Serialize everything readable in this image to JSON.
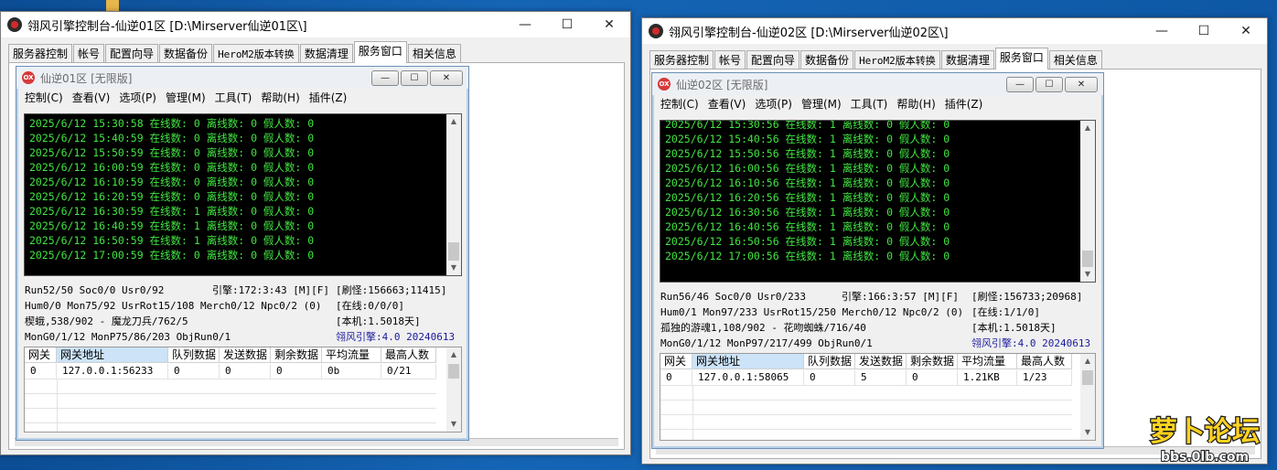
{
  "windows": [
    {
      "title": "翎风引擎控制台-仙逆01区 [D:\\Mirserver仙逆01区\\]",
      "tabs": [
        "服务器控制",
        "帐号",
        "配置向导",
        "数据备份",
        "HeroM2版本转换",
        "数据清理",
        "服务窗口",
        "相关信息"
      ],
      "active_tab": "服务窗口",
      "inner": {
        "title": "仙逆01区 [无限版]",
        "icon_text": "OX",
        "menus": [
          "控制(C)",
          "查看(V)",
          "选项(P)",
          "管理(M)",
          "工具(T)",
          "帮助(H)",
          "插件(Z)"
        ],
        "log": [
          "2025/6/12 15:30:58 在线数: 0 离线数: 0 假人数: 0",
          "2025/6/12 15:40:59 在线数: 0 离线数: 0 假人数: 0",
          "2025/6/12 15:50:59 在线数: 0 离线数: 0 假人数: 0",
          "2025/6/12 16:00:59 在线数: 0 离线数: 0 假人数: 0",
          "2025/6/12 16:10:59 在线数: 0 离线数: 0 假人数: 0",
          "2025/6/12 16:20:59 在线数: 0 离线数: 0 假人数: 0",
          "2025/6/12 16:30:59 在线数: 1 离线数: 0 假人数: 0",
          "2025/6/12 16:40:59 在线数: 1 离线数: 0 假人数: 0",
          "2025/6/12 16:50:59 在线数: 1 离线数: 0 假人数: 0",
          "2025/6/12 17:00:59 在线数: 0 离线数: 0 假人数: 0"
        ],
        "status": {
          "r1a": "Run52/50 Soc0/0 Usr0/92",
          "r1b": "引擎:172:3:43 [M][F]",
          "r1c": "[刷怪:156663;11415]",
          "r2a": "Hum0/0 Mon75/92 UsrRot15/108 Merch0/12 Npc0/2 (0)",
          "r2c": "[在线:0/0/0]",
          "r3a": "楔蛾,538/902 - 魔龙刀兵/762/5",
          "r3c": "[本机:1.5018天]",
          "r4a": "MonG0/1/12 MonP75/86/203 ObjRun0/1",
          "r4c": "翎风引擎:4.0 20240613"
        },
        "grid_headers": [
          "网关",
          "网关地址",
          "队列数据",
          "发送数据",
          "剩余数据",
          "平均流量",
          "最高人数"
        ],
        "grid_rows": [
          [
            "0",
            "127.0.0.1:56233",
            "0",
            "0",
            "0",
            "0b",
            "0/21"
          ]
        ]
      }
    },
    {
      "title": "翎风引擎控制台-仙逆02区 [D:\\Mirserver仙逆02区\\]",
      "tabs": [
        "服务器控制",
        "帐号",
        "配置向导",
        "数据备份",
        "HeroM2版本转换",
        "数据清理",
        "服务窗口",
        "相关信息"
      ],
      "active_tab": "服务窗口",
      "inner": {
        "title": "仙逆02区 [无限版]",
        "icon_text": "OX",
        "menus": [
          "控制(C)",
          "查看(V)",
          "选项(P)",
          "管理(M)",
          "工具(T)",
          "帮助(H)",
          "插件(Z)"
        ],
        "log": [
          "2025/6/12 15:30:56 在线数: 1 离线数: 0 假人数: 0",
          "2025/6/12 15:40:56 在线数: 1 离线数: 0 假人数: 0",
          "2025/6/12 15:50:56 在线数: 1 离线数: 0 假人数: 0",
          "2025/6/12 16:00:56 在线数: 1 离线数: 0 假人数: 0",
          "2025/6/12 16:10:56 在线数: 1 离线数: 0 假人数: 0",
          "2025/6/12 16:20:56 在线数: 1 离线数: 0 假人数: 0",
          "2025/6/12 16:30:56 在线数: 1 离线数: 0 假人数: 0",
          "2025/6/12 16:40:56 在线数: 1 离线数: 0 假人数: 0",
          "2025/6/12 16:50:56 在线数: 1 离线数: 0 假人数: 0",
          "2025/6/12 17:00:56 在线数: 1 离线数: 0 假人数: 0"
        ],
        "status": {
          "r1a": "Run56/46 Soc0/0 Usr0/233",
          "r1b": "引擎:166:3:57 [M][F]",
          "r1c": "[刷怪:156733;20968]",
          "r2a": "Hum0/1 Mon97/233 UsrRot15/250 Merch0/12 Npc0/2 (0)",
          "r2c": "[在线:1/1/0]",
          "r3a": "孤独的游魂1,108/902 - 花吻蜘蛛/716/40",
          "r3c": "[本机:1.5018天]",
          "r4a": "MonG0/1/12 MonP97/217/499 ObjRun0/1",
          "r4c": "翎风引擎:4.0 20240613"
        },
        "grid_headers": [
          "网关",
          "网关地址",
          "队列数据",
          "发送数据",
          "剩余数据",
          "平均流量",
          "最高人数"
        ],
        "grid_rows": [
          [
            "0",
            "127.0.0.1:58065",
            "0",
            "5",
            "0",
            "1.21KB",
            "1/23"
          ]
        ]
      }
    }
  ],
  "caption_buttons": {
    "minimize": "—",
    "maximize": "☐",
    "close": "✕"
  },
  "watermark": {
    "top": "萝卜论坛",
    "bottom": "bbs.0lb.com"
  },
  "colors": {
    "console_bg": "#000000",
    "console_text": "#42e542",
    "header_selected": "#cce3f8"
  }
}
